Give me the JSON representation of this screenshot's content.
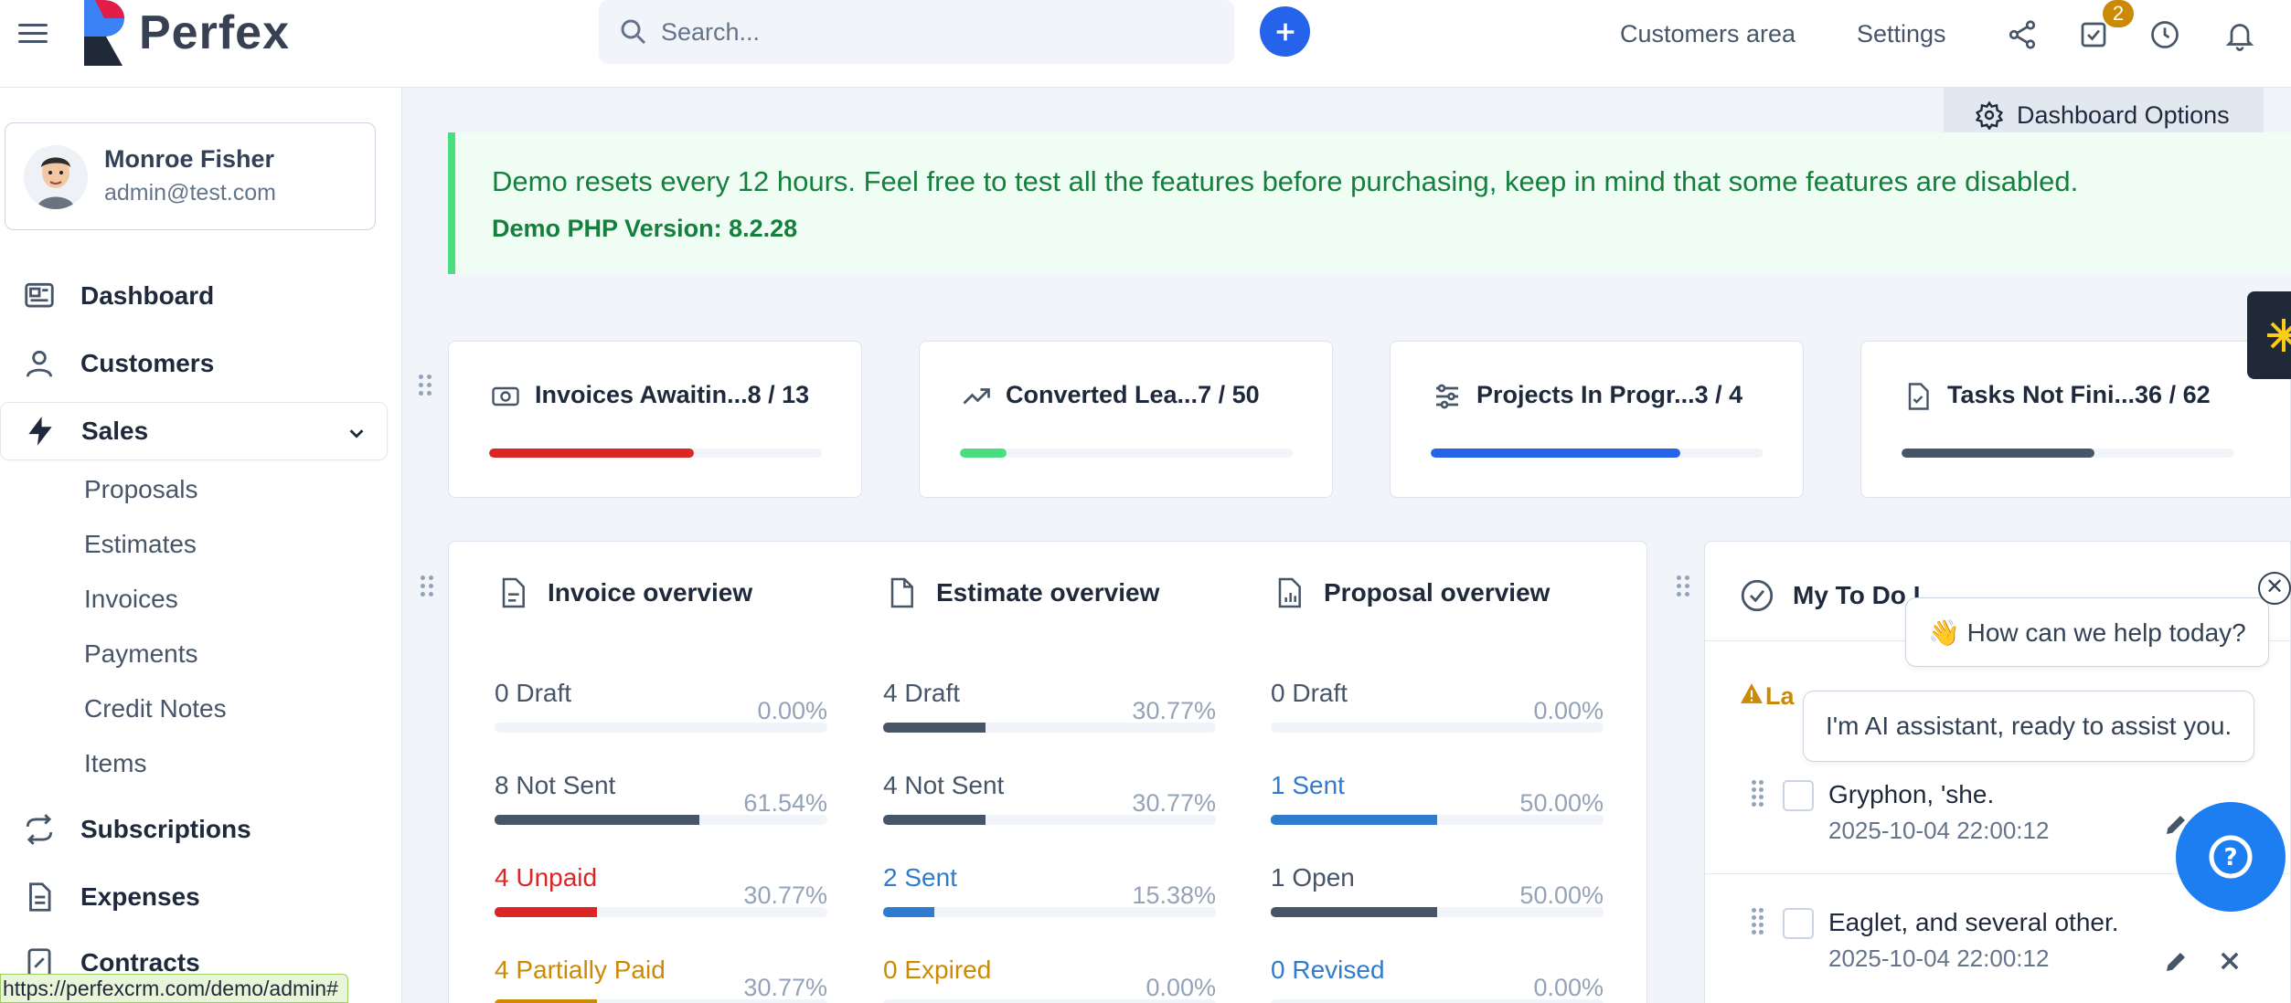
{
  "header": {
    "logo_text": "Perfex",
    "search_placeholder": "Search...",
    "links": {
      "customers_area": "Customers area",
      "settings": "Settings"
    },
    "notification_badge": "2"
  },
  "sidebar": {
    "profile": {
      "name": "Monroe Fisher",
      "email": "admin@test.com"
    },
    "nav": {
      "dashboard": "Dashboard",
      "customers": "Customers",
      "sales": "Sales",
      "subscriptions": "Subscriptions",
      "expenses": "Expenses",
      "contracts": "Contracts"
    },
    "sales_sub": [
      "Proposals",
      "Estimates",
      "Invoices",
      "Payments",
      "Credit Notes",
      "Items"
    ]
  },
  "main": {
    "dashboard_options": "Dashboard Options",
    "alert": {
      "message": "Demo resets every 12 hours. Feel free to test all the features before purchasing, keep in mind that some features are disabled.",
      "version": "Demo PHP Version: 8.2.28"
    },
    "stats": [
      {
        "label": "Invoices Awaitin...",
        "value": "8 / 13",
        "progress": 0.615,
        "color": "#dc2626"
      },
      {
        "label": "Converted Lea...",
        "value": "7 / 50",
        "progress": 0.14,
        "color": "#4ade80"
      },
      {
        "label": "Projects In Progr...",
        "value": "3 / 4",
        "progress": 0.75,
        "color": "#2563eb"
      },
      {
        "label": "Tasks Not Fini...",
        "value": "36 / 62",
        "progress": 0.58,
        "color": "#475569"
      }
    ],
    "overviews": [
      {
        "title": "Invoice overview",
        "rows": [
          {
            "count": "0",
            "status": "Draft",
            "pct": "0.00%",
            "progress": 0.0,
            "color": "#475569",
            "text_color": "#475569"
          },
          {
            "count": "8",
            "status": "Not Sent",
            "pct": "61.54%",
            "progress": 0.6154,
            "color": "#475569",
            "text_color": "#475569"
          },
          {
            "count": "4",
            "status": "Unpaid",
            "pct": "30.77%",
            "progress": 0.3077,
            "color": "#dc2626",
            "text_color": "#dc2626"
          },
          {
            "count": "4",
            "status": "Partially Paid",
            "pct": "30.77%",
            "progress": 0.3077,
            "color": "#ca8a04",
            "text_color": "#ca8a04"
          }
        ]
      },
      {
        "title": "Estimate overview",
        "rows": [
          {
            "count": "4",
            "status": "Draft",
            "pct": "30.77%",
            "progress": 0.3077,
            "color": "#475569",
            "text_color": "#475569"
          },
          {
            "count": "4",
            "status": "Not Sent",
            "pct": "30.77%",
            "progress": 0.3077,
            "color": "#475569",
            "text_color": "#475569"
          },
          {
            "count": "2",
            "status": "Sent",
            "pct": "15.38%",
            "progress": 0.1538,
            "color": "#2f7bd0",
            "text_color": "#2f7bd0"
          },
          {
            "count": "0",
            "status": "Expired",
            "pct": "0.00%",
            "progress": 0.0,
            "color": "#ca8a04",
            "text_color": "#ca8a04"
          }
        ]
      },
      {
        "title": "Proposal overview",
        "rows": [
          {
            "count": "0",
            "status": "Draft",
            "pct": "0.00%",
            "progress": 0.0,
            "color": "#475569",
            "text_color": "#475569"
          },
          {
            "count": "1",
            "status": "Sent",
            "pct": "50.00%",
            "progress": 0.5,
            "color": "#2f7bd0",
            "text_color": "#2f7bd0"
          },
          {
            "count": "1",
            "status": "Open",
            "pct": "50.00%",
            "progress": 0.5,
            "color": "#475569",
            "text_color": "#475569"
          },
          {
            "count": "0",
            "status": "Revised",
            "pct": "0.00%",
            "progress": 0.0,
            "color": "#2f7bd0",
            "text_color": "#2f7bd0"
          }
        ]
      }
    ],
    "todo": {
      "title": "My To Do I",
      "latest_label": "La",
      "items": [
        {
          "text": "Gryphon, 'she.",
          "date": "2025-10-04 22:00:12"
        },
        {
          "text": "Eaglet, and several other.",
          "date": "2025-10-04 22:00:12"
        }
      ]
    }
  },
  "chat": {
    "greeting": "👋 How can we help today?",
    "assistant": "I'm AI assistant, ready to assist you.",
    "close_glyph": "✕",
    "help_glyph": "?"
  },
  "status_url": "https://perfexcrm.com/demo/admin#"
}
